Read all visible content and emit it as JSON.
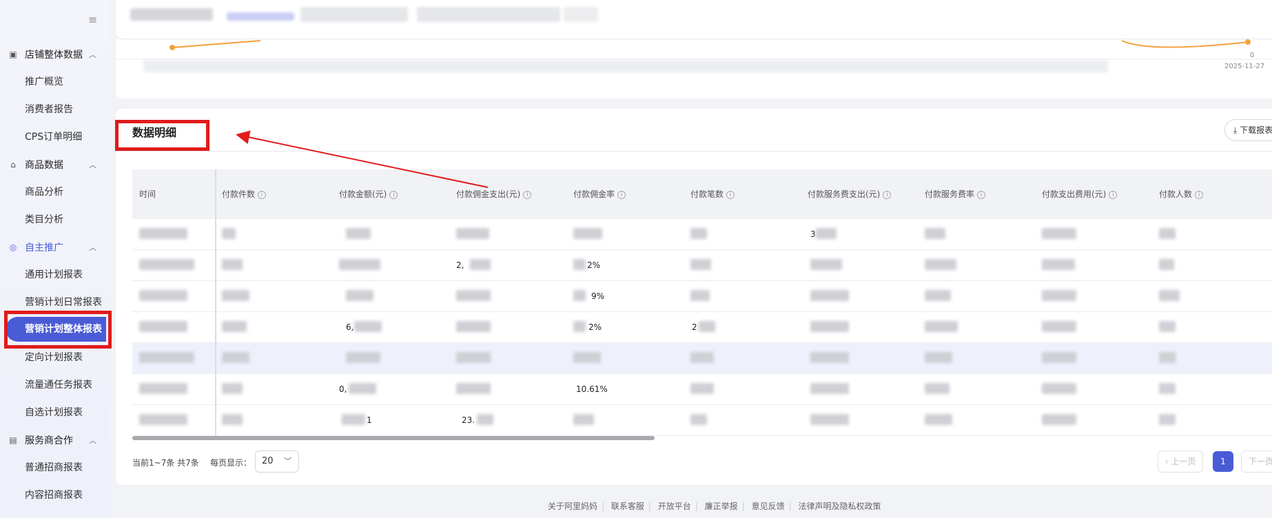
{
  "sidebar": {
    "groups": [
      {
        "label": "店铺整体数据",
        "items": [
          "推广概览",
          "消费者报告",
          "CPS订单明细"
        ]
      },
      {
        "label": "商品数据",
        "items": [
          "商品分析",
          "类目分析"
        ]
      },
      {
        "label": "自主推广",
        "items": [
          "通用计划报表",
          "营销计划日常报表",
          "营销计划整体报表",
          "定向计划报表",
          "流量通任务报表",
          "自选计划报表"
        ]
      },
      {
        "label": "服务商合作",
        "items": [
          "普通招商报表",
          "内容招商报表"
        ]
      }
    ],
    "selected_item": "营销计划整体报表",
    "active_group": "自主推广"
  },
  "chart": {
    "axis_right_value": "0",
    "axis_right_date": "2025-11-27"
  },
  "detail": {
    "title": "数据明细",
    "download_label": "下载报表",
    "columns": [
      "时间",
      "付款件数",
      "付款金额(元)",
      "付款佣金支出(元)",
      "付款佣金率",
      "付款笔数",
      "付款服务费支出(元)",
      "付款服务费率",
      "付款支出费用(元)",
      "付款人数"
    ],
    "visible_cells": {
      "r2_c3": "2,",
      "r2_c4": "2%",
      "r3_c4": "9%",
      "r4_c2": "6,",
      "r4_c4": "2%",
      "r4_c5": "2",
      "r6_c2": "0,",
      "r6_c4": "10.61%",
      "r7_c2": "1",
      "r7_c3": "23.",
      "r1_c6": "3"
    },
    "pager_info": "当前1~7条 共7条",
    "page_size_label": "每页显示：",
    "page_size": "20",
    "prev_label": "上一页",
    "current_page": "1",
    "next_label": "下一页"
  },
  "footer": {
    "links": [
      "关于阿里妈妈",
      "联系客服",
      "开放平台",
      "廉正举报",
      "意见反馈",
      "法律声明及隐私权政策"
    ]
  },
  "colors": {
    "accent": "#4a5bd6",
    "annotation_red": "#e01b1b",
    "chart_line": "#f5a03a"
  }
}
